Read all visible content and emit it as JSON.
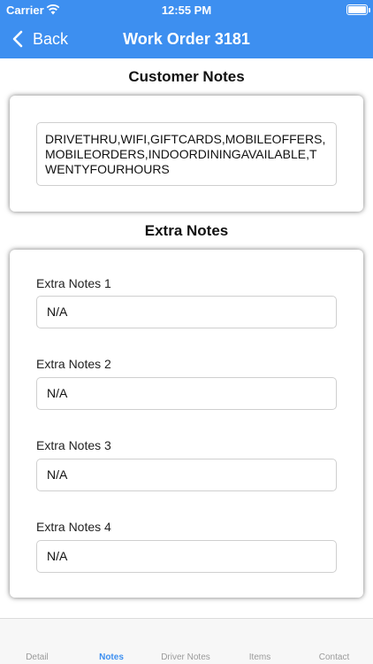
{
  "status_bar": {
    "carrier": "Carrier",
    "time": "12:55 PM"
  },
  "nav": {
    "back_label": "Back",
    "title": "Work Order 3181"
  },
  "customer_notes": {
    "title": "Customer Notes",
    "text": "DRIVETHRU,WIFI,GIFTCARDS,MOBILEOFFERS,MOBILEORDERS,INDOORDININGAVAILABLE,TWENTYFOURHOURS"
  },
  "extra_notes": {
    "title": "Extra Notes",
    "fields": [
      {
        "label": "Extra Notes 1",
        "value": "N/A"
      },
      {
        "label": "Extra Notes 2",
        "value": "N/A"
      },
      {
        "label": "Extra Notes 3",
        "value": "N/A"
      },
      {
        "label": "Extra Notes 4",
        "value": "N/A"
      }
    ]
  },
  "tabs": [
    {
      "label": "Detail"
    },
    {
      "label": "Notes",
      "active": true
    },
    {
      "label": "Driver Notes"
    },
    {
      "label": "Items"
    },
    {
      "label": "Contact"
    }
  ],
  "colors": {
    "accent": "#3d8ff0",
    "tab_inactive": "#9a9a9a"
  }
}
